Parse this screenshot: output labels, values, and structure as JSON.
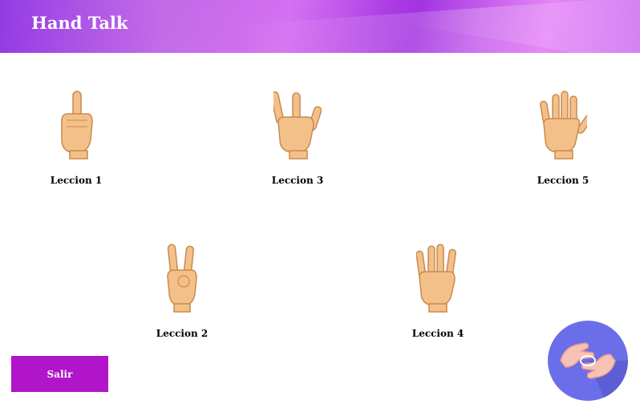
{
  "app": {
    "title": "Hand Talk"
  },
  "lessons": [
    {
      "label": "Leccion 1",
      "fingers": 1,
      "icon": "one-finger-hand-icon"
    },
    {
      "label": "Leccion 2",
      "fingers": 2,
      "icon": "two-fingers-hand-icon"
    },
    {
      "label": "Leccion 3",
      "fingers": 3,
      "icon": "three-fingers-hand-icon"
    },
    {
      "label": "Leccion 4",
      "fingers": 4,
      "icon": "four-fingers-hand-icon"
    },
    {
      "label": "Leccion 5",
      "fingers": 5,
      "icon": "five-fingers-hand-icon"
    }
  ],
  "exit": {
    "label": "Salir"
  },
  "colors": {
    "header": "#b040e0",
    "exit_button": "#b015c9",
    "logo_circle": "#6a6ee8",
    "skin": "#f4c08a"
  }
}
